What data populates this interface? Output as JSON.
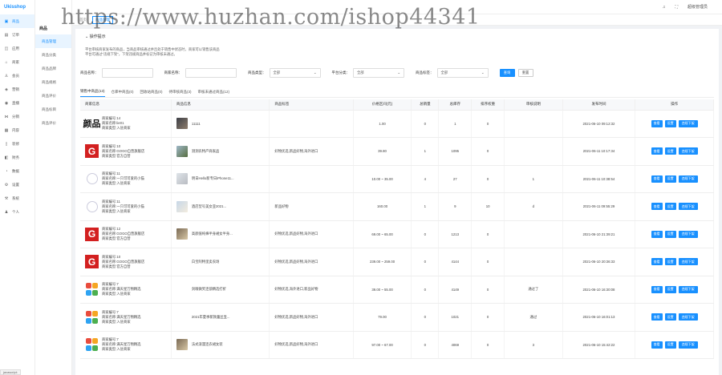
{
  "app": {
    "logo": "Ukisshop",
    "watermark": "https://www.huzhan.com/ishop44341"
  },
  "sidebar": {
    "items": [
      {
        "label": "商品",
        "icon": "bag-icon",
        "glyph": "▣"
      },
      {
        "label": "订单",
        "icon": "order-icon",
        "glyph": "▤"
      },
      {
        "label": "应用",
        "icon": "app-icon",
        "glyph": "◫"
      },
      {
        "label": "商家",
        "icon": "store-icon",
        "glyph": "⌂"
      },
      {
        "label": "会员",
        "icon": "user-icon",
        "glyph": "♙"
      },
      {
        "label": "营销",
        "icon": "megaphone-icon",
        "glyph": "◈"
      },
      {
        "label": "直播",
        "icon": "live-icon",
        "glyph": "◉"
      },
      {
        "label": "分销",
        "icon": "share-icon",
        "glyph": "⋈"
      },
      {
        "label": "内容",
        "icon": "content-icon",
        "glyph": "▦"
      },
      {
        "label": "装修",
        "icon": "brush-icon",
        "glyph": "▯"
      },
      {
        "label": "财务",
        "icon": "wallet-icon",
        "glyph": "◧"
      },
      {
        "label": "数据",
        "icon": "chart-icon",
        "glyph": "◔"
      },
      {
        "label": "设置",
        "icon": "gear-icon",
        "glyph": "⚙"
      },
      {
        "label": "系统",
        "icon": "system-icon",
        "glyph": "⚒"
      },
      {
        "label": "个人",
        "icon": "person-icon",
        "glyph": "♟"
      }
    ]
  },
  "subnav": {
    "title": "商品",
    "items": [
      "商品管理",
      "商品分类",
      "商品品牌",
      "商品规格",
      "商品评价",
      "商品标目",
      "商品评价"
    ]
  },
  "topbar": {
    "refresh": "C",
    "admin": "超级管理员",
    "bell": "♫",
    "expand": "⛶"
  },
  "tagbar": {
    "items": [
      "首页",
      "商品管理"
    ]
  },
  "tip": {
    "title": "操作提示",
    "lines": [
      "平台审核商家发布的商品，当商品审核通过并且处于销售中状态时，商家可以销售该商品",
      "平台可通过\"违规下架\"，下架违规商品并标记为审核未通过。"
    ]
  },
  "filters": {
    "name_label": "商品名称：",
    "name_placeholder": "",
    "merchant_label": "商家名称：",
    "merchant_placeholder": "",
    "type_label": "商品类型：",
    "type_value": "全部",
    "cat_label": "平台分类：",
    "cat_value": "全部",
    "shop_label": "商品标签：",
    "shop_value": "全部",
    "search": "查询",
    "reset": "重置"
  },
  "tabs": [
    "销售中商品(13)",
    "仓库中商品(0)",
    "回收站商品(0)",
    "待审核商品(3)",
    "审核未通过商品(12)"
  ],
  "table": {
    "headers": [
      "商家信息",
      "商品信息",
      "商品标签",
      "价格区间(元)",
      "总销量",
      "总库存",
      "排序权重",
      "审核说明",
      "发布时间",
      "操作"
    ],
    "rows": [
      {
        "logo": "k",
        "logo_text": "颜品",
        "m1": "商家编号:14",
        "m2": "商家名称:lie01",
        "m3": "商家类型:入驻商家",
        "thumb": "t5",
        "pname": "11111",
        "tags": "",
        "price": "1.00",
        "sales": "0",
        "stock": "1",
        "weight": "0",
        "note": "",
        "time": "2021-06-10 09:12:32"
      },
      {
        "logo": "g",
        "logo_text": "G",
        "m1": "商家编号:10",
        "m2": "商家名称:GOGO自营旗舰店",
        "m3": "商家类型:官方自营",
        "thumb": "t2",
        "pname": "测测农特产商家品",
        "tags": "好物优选,新品好物,海外进口",
        "price": "39.80",
        "sales": "1",
        "stock": "1095",
        "weight": "0",
        "note": "",
        "time": "2021-06-11 10:17:34"
      },
      {
        "logo": "c",
        "logo_text": "",
        "m1": "商家编号:11",
        "m2": "商家名称:一只可可爱的小猫",
        "m3": "商家类型:入驻商家",
        "thumb": "t3",
        "pname": "明日Hello新专日iPhone11...",
        "tags": "",
        "price": "10.00 ~ 35.00",
        "sales": "4",
        "stock": "27",
        "weight": "0",
        "note": "1",
        "time": "2021-06-11 10:38:54"
      },
      {
        "logo": "c",
        "logo_text": "",
        "m1": "商家编号:11",
        "m2": "商家名称:一只可可爱的小猫",
        "m3": "商家类型:入驻商家",
        "thumb": "t4",
        "pname": "酒店型号美女亚2021...",
        "tags": "新品好物",
        "price": "160.00",
        "sales": "1",
        "stock": "9",
        "weight": "10",
        "note": "d",
        "time": "2021-06-11 09:55:29"
      },
      {
        "logo": "g",
        "logo_text": "G",
        "m1": "商家编号:12",
        "m2": "商家名称:GOGO自营旗舰店",
        "m3": "商家类型:官方自营",
        "thumb": "t1",
        "pname": "高颜值纯棉半身裙女半身...",
        "tags": "好物优选,新品好物,海外进口",
        "price": "69.00 ~ 65.00",
        "sales": "0",
        "stock": "1213",
        "weight": "0",
        "note": "",
        "time": "2021-06-10 21:39:21"
      },
      {
        "logo": "g",
        "logo_text": "G",
        "m1": "商家编号:10",
        "m2": "商家名称:GOGO自营旗舰店",
        "m3": "商家类型:官方自营",
        "thumb": "none",
        "pname": "白宝阿特里卖农场",
        "tags": "好物优选,新品好物,海外进口",
        "price": "239.00 ~ 259.00",
        "sales": "0",
        "stock": "4144",
        "weight": "0",
        "note": "",
        "time": "2021-06-10 20:36:33"
      },
      {
        "logo": "b",
        "logo_text": "",
        "m1": "商家编号:7",
        "m2": "商家名称:满天星万物精选",
        "m3": "商家类型:入驻商家",
        "thumb": "none",
        "pname": "剑眼微笑连锁精选打折",
        "tags": "好物优选,海外进口,新品好物",
        "price": "39.00 ~ 55.00",
        "sales": "0",
        "stock": "4149",
        "weight": "0",
        "note": "通过了",
        "time": "2021-06-10 16:30:08"
      },
      {
        "logo": "b",
        "logo_text": "",
        "m1": "商家编号:7",
        "m2": "商家名称:满天星万物精选",
        "m3": "商家类型:入驻商家",
        "thumb": "none",
        "pname": "2021年夏季新款蕾丝显...",
        "tags": "好物优选,新品好物,海外进口",
        "price": "79.00",
        "sales": "0",
        "stock": "1021",
        "weight": "0",
        "note": "通过",
        "time": "2021-06-10 16:01:13"
      },
      {
        "logo": "b",
        "logo_text": "",
        "m1": "商家编号:7",
        "m2": "商家名称:满天星万物精选",
        "m3": "商家类型:入驻商家",
        "thumb": "t1",
        "pname": "法式浪漫连衣裙女装",
        "tags": "好物优选,新品好物,海外进口",
        "price": "97.00 ~ 67.00",
        "sales": "0",
        "stock": "4069",
        "weight": "0",
        "note": "3",
        "time": "2021-06-10 15:42:22"
      }
    ],
    "ops": [
      "查看",
      "设置",
      "违规下架"
    ]
  },
  "colors": {
    "accent": "#1890ff",
    "brand_red": "#d32020"
  },
  "statusbar": "javascript:"
}
